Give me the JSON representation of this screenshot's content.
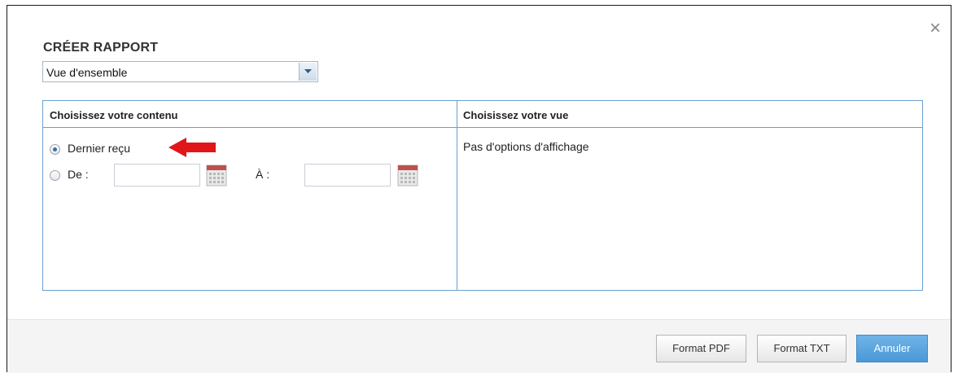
{
  "dialog": {
    "title": "CRÉER RAPPORT",
    "close_icon": "close-icon"
  },
  "report_type": {
    "selected": "Vue d'ensemble",
    "arrow_icon": "chevron-down-icon"
  },
  "content_panel": {
    "header": "Choisissez votre contenu",
    "option_latest": {
      "label": "Dernier reçu",
      "checked": true
    },
    "option_range": {
      "label": "De :",
      "checked": false
    },
    "to_label": "À :",
    "from_value": "",
    "to_value": "",
    "calendar_icon": "calendar-icon",
    "annotation_icon": "red-arrow-icon"
  },
  "view_panel": {
    "header": "Choisissez votre vue",
    "message": "Pas d'options d'affichage"
  },
  "footer": {
    "pdf_label": "Format PDF",
    "txt_label": "Format TXT",
    "cancel_label": "Annuler"
  },
  "colors": {
    "accent_blue": "#4b98d6",
    "panel_border": "#6aa0cf",
    "annotation_red": "#e0161b"
  }
}
